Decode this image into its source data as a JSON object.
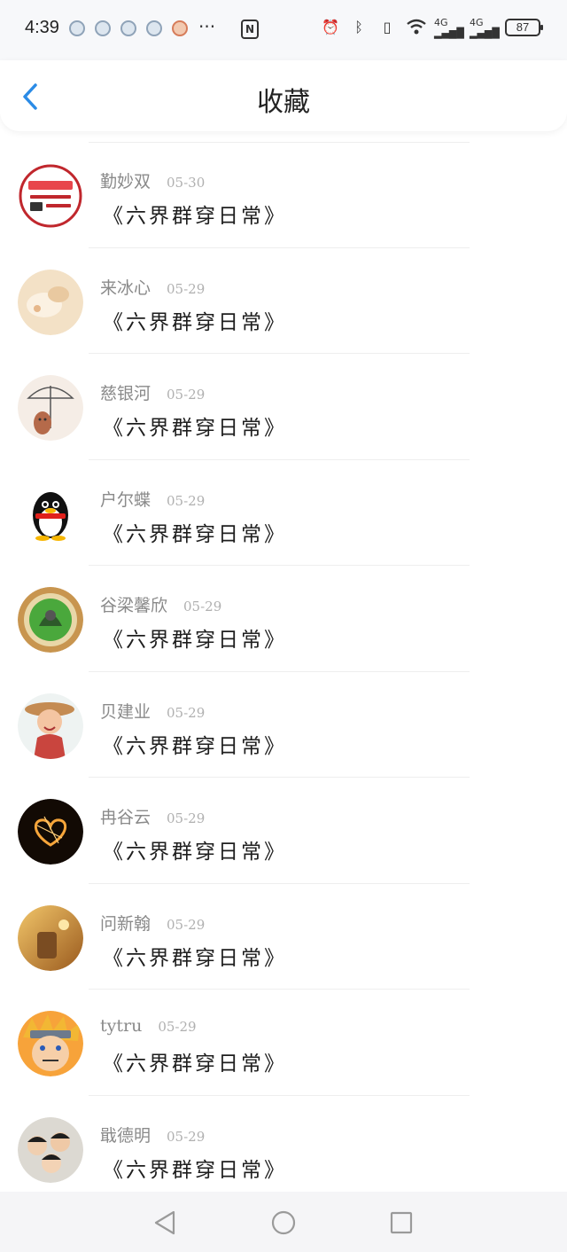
{
  "status_bar": {
    "time": "4:39",
    "more": "···",
    "nfc": "N",
    "battery": "87",
    "network_1": "4G",
    "network_2": "4G"
  },
  "header": {
    "title": "收藏"
  },
  "items": [
    {
      "name": "勤妙双",
      "date": "05-30",
      "title": "《六界群穿日常》",
      "avatar_icon": "banner-avatar"
    },
    {
      "name": "来冰心",
      "date": "05-29",
      "title": "《六界群穿日常》",
      "avatar_icon": "cream-avatar"
    },
    {
      "name": "慈银河",
      "date": "05-29",
      "title": "《六界群穿日常》",
      "avatar_icon": "umbrella-avatar"
    },
    {
      "name": "户尔蝶",
      "date": "05-29",
      "title": "《六界群穿日常》",
      "avatar_icon": "penguin-avatar"
    },
    {
      "name": "谷梁馨欣",
      "date": "05-29",
      "title": "《六界群穿日常》",
      "avatar_icon": "badge-avatar"
    },
    {
      "name": "贝建业",
      "date": "05-29",
      "title": "《六界群穿日常》",
      "avatar_icon": "girl-avatar"
    },
    {
      "name": "冉谷云",
      "date": "05-29",
      "title": "《六界群穿日常》",
      "avatar_icon": "sparkler-heart-avatar"
    },
    {
      "name": "问新翰",
      "date": "05-29",
      "title": "《六界群穿日常》",
      "avatar_icon": "autumn-avatar"
    },
    {
      "name": "tytru",
      "date": "05-29",
      "title": "《六界群穿日常》",
      "avatar_icon": "anime-avatar"
    },
    {
      "name": "戢德明",
      "date": "05-29",
      "title": "《六界群穿日常》",
      "avatar_icon": "friends-avatar"
    }
  ],
  "colors": {
    "accent": "#2b8be6",
    "name_text": "#8a8a8a",
    "date_text": "#b0b0b0"
  }
}
